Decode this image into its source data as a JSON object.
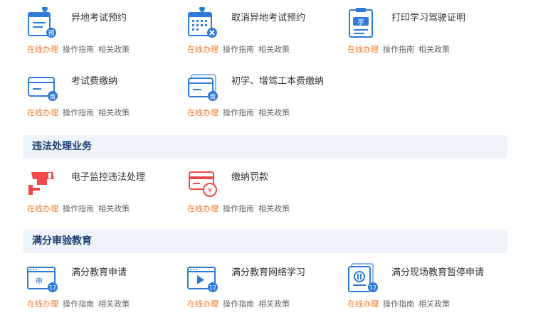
{
  "link_labels": {
    "online": "在线办理",
    "guide": "操作指南",
    "policy": "相关政策"
  },
  "rows": [
    {
      "items": [
        {
          "title": "异地考试预约",
          "icon": "calendar-pin-icon",
          "badge": "预"
        },
        {
          "title": "取消异地考试预约",
          "icon": "calendar-cancel-icon"
        },
        {
          "title": "打印学习驾驶证明",
          "icon": "license-print-icon",
          "badge": "学"
        }
      ]
    },
    {
      "items": [
        {
          "title": "考试费缴纳",
          "icon": "payment-card-icon",
          "badge": "缴"
        },
        {
          "title": "初学、增驾工本费缴纳",
          "icon": "payment-cards-icon",
          "badge": "缴"
        }
      ]
    }
  ],
  "sections": [
    {
      "title": "违法处理业务",
      "items": [
        {
          "title": "电子监控违法处理",
          "icon": "surveillance-camera-icon"
        },
        {
          "title": "缴纳罚款",
          "icon": "fine-payment-icon",
          "badge": "¥"
        }
      ]
    },
    {
      "title": "满分审验教育",
      "items": [
        {
          "title": "满分教育申请",
          "icon": "application-window-icon",
          "badge": "12",
          "label": "申"
        },
        {
          "title": "满分教育网络学习",
          "icon": "video-window-icon",
          "badge": "12"
        },
        {
          "title": "满分现场教育暂停申请",
          "icon": "pause-document-icon",
          "badge": "12"
        }
      ]
    }
  ],
  "colors": {
    "accent": "#2f7bd8",
    "link_orange": "#f07b2b",
    "violation_red": "#f0494a",
    "section_bg": "#eef4fa"
  }
}
